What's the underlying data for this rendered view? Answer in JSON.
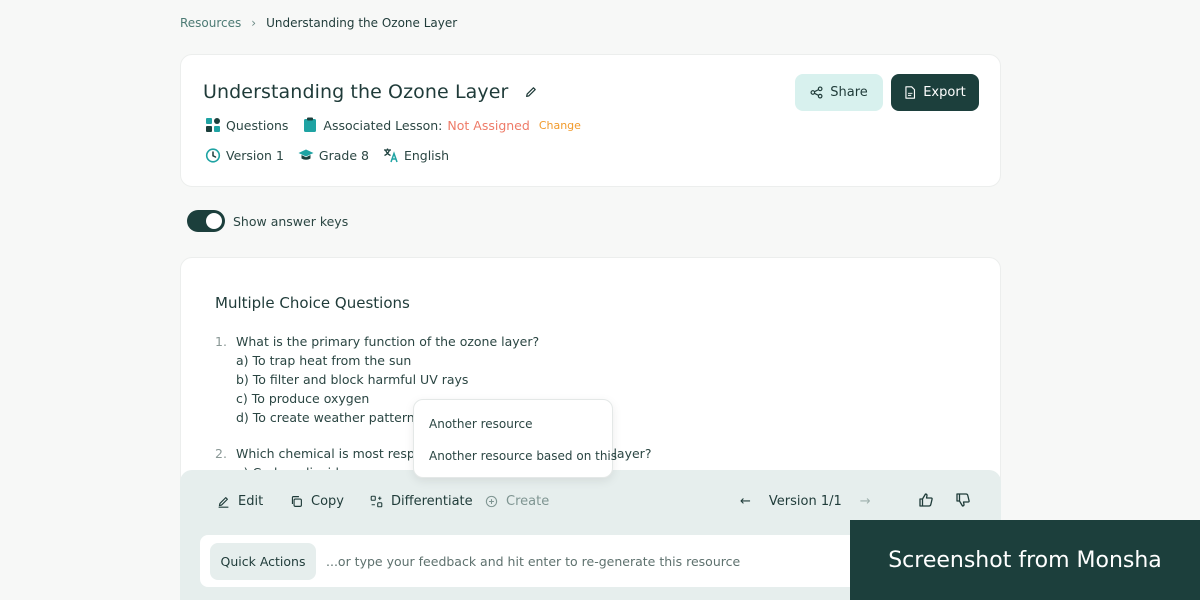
{
  "breadcrumb": {
    "parent": "Resources",
    "separator": "›",
    "current": "Understanding the Ozone Layer"
  },
  "header": {
    "title": "Understanding the Ozone Layer",
    "questions_label": "Questions",
    "lesson_label": "Associated Lesson:",
    "lesson_value": "Not Assigned",
    "change_label": "Change",
    "version_label": "Version 1",
    "grade_label": "Grade 8",
    "language_label": "English",
    "share_label": "Share",
    "export_label": "Export"
  },
  "toggle": {
    "label": "Show answer keys",
    "on": true
  },
  "content": {
    "section_title": "Multiple Choice Questions",
    "questions": [
      {
        "number": "1.",
        "text": "What is the primary function of the ozone layer?",
        "options": [
          "a) To trap heat from the sun",
          "b) To filter and block harmful UV rays",
          "c) To produce oxygen",
          "d) To create weather patterns"
        ]
      },
      {
        "number": "2.",
        "text": "Which chemical is most responsible for depleting the ozone layer?",
        "options": [
          "a) Carbon dioxide"
        ]
      }
    ]
  },
  "dropdown": {
    "items": [
      "Another resource",
      "Another resource based on this"
    ]
  },
  "actions": {
    "edit": "Edit",
    "copy": "Copy",
    "differentiate": "Differentiate",
    "create": "Create",
    "version": "Version 1/1"
  },
  "feedback": {
    "quick_actions": "Quick Actions",
    "placeholder": "...or type your feedback and hit enter to re-generate this resource"
  },
  "watermark": "Screenshot from Monsha",
  "colors": {
    "primary": "#1c3f3c",
    "accent_light": "#d8f1ee",
    "warning": "#ee7b68",
    "change": "#f19a2b",
    "icon_teal": "#1fa3a3"
  }
}
